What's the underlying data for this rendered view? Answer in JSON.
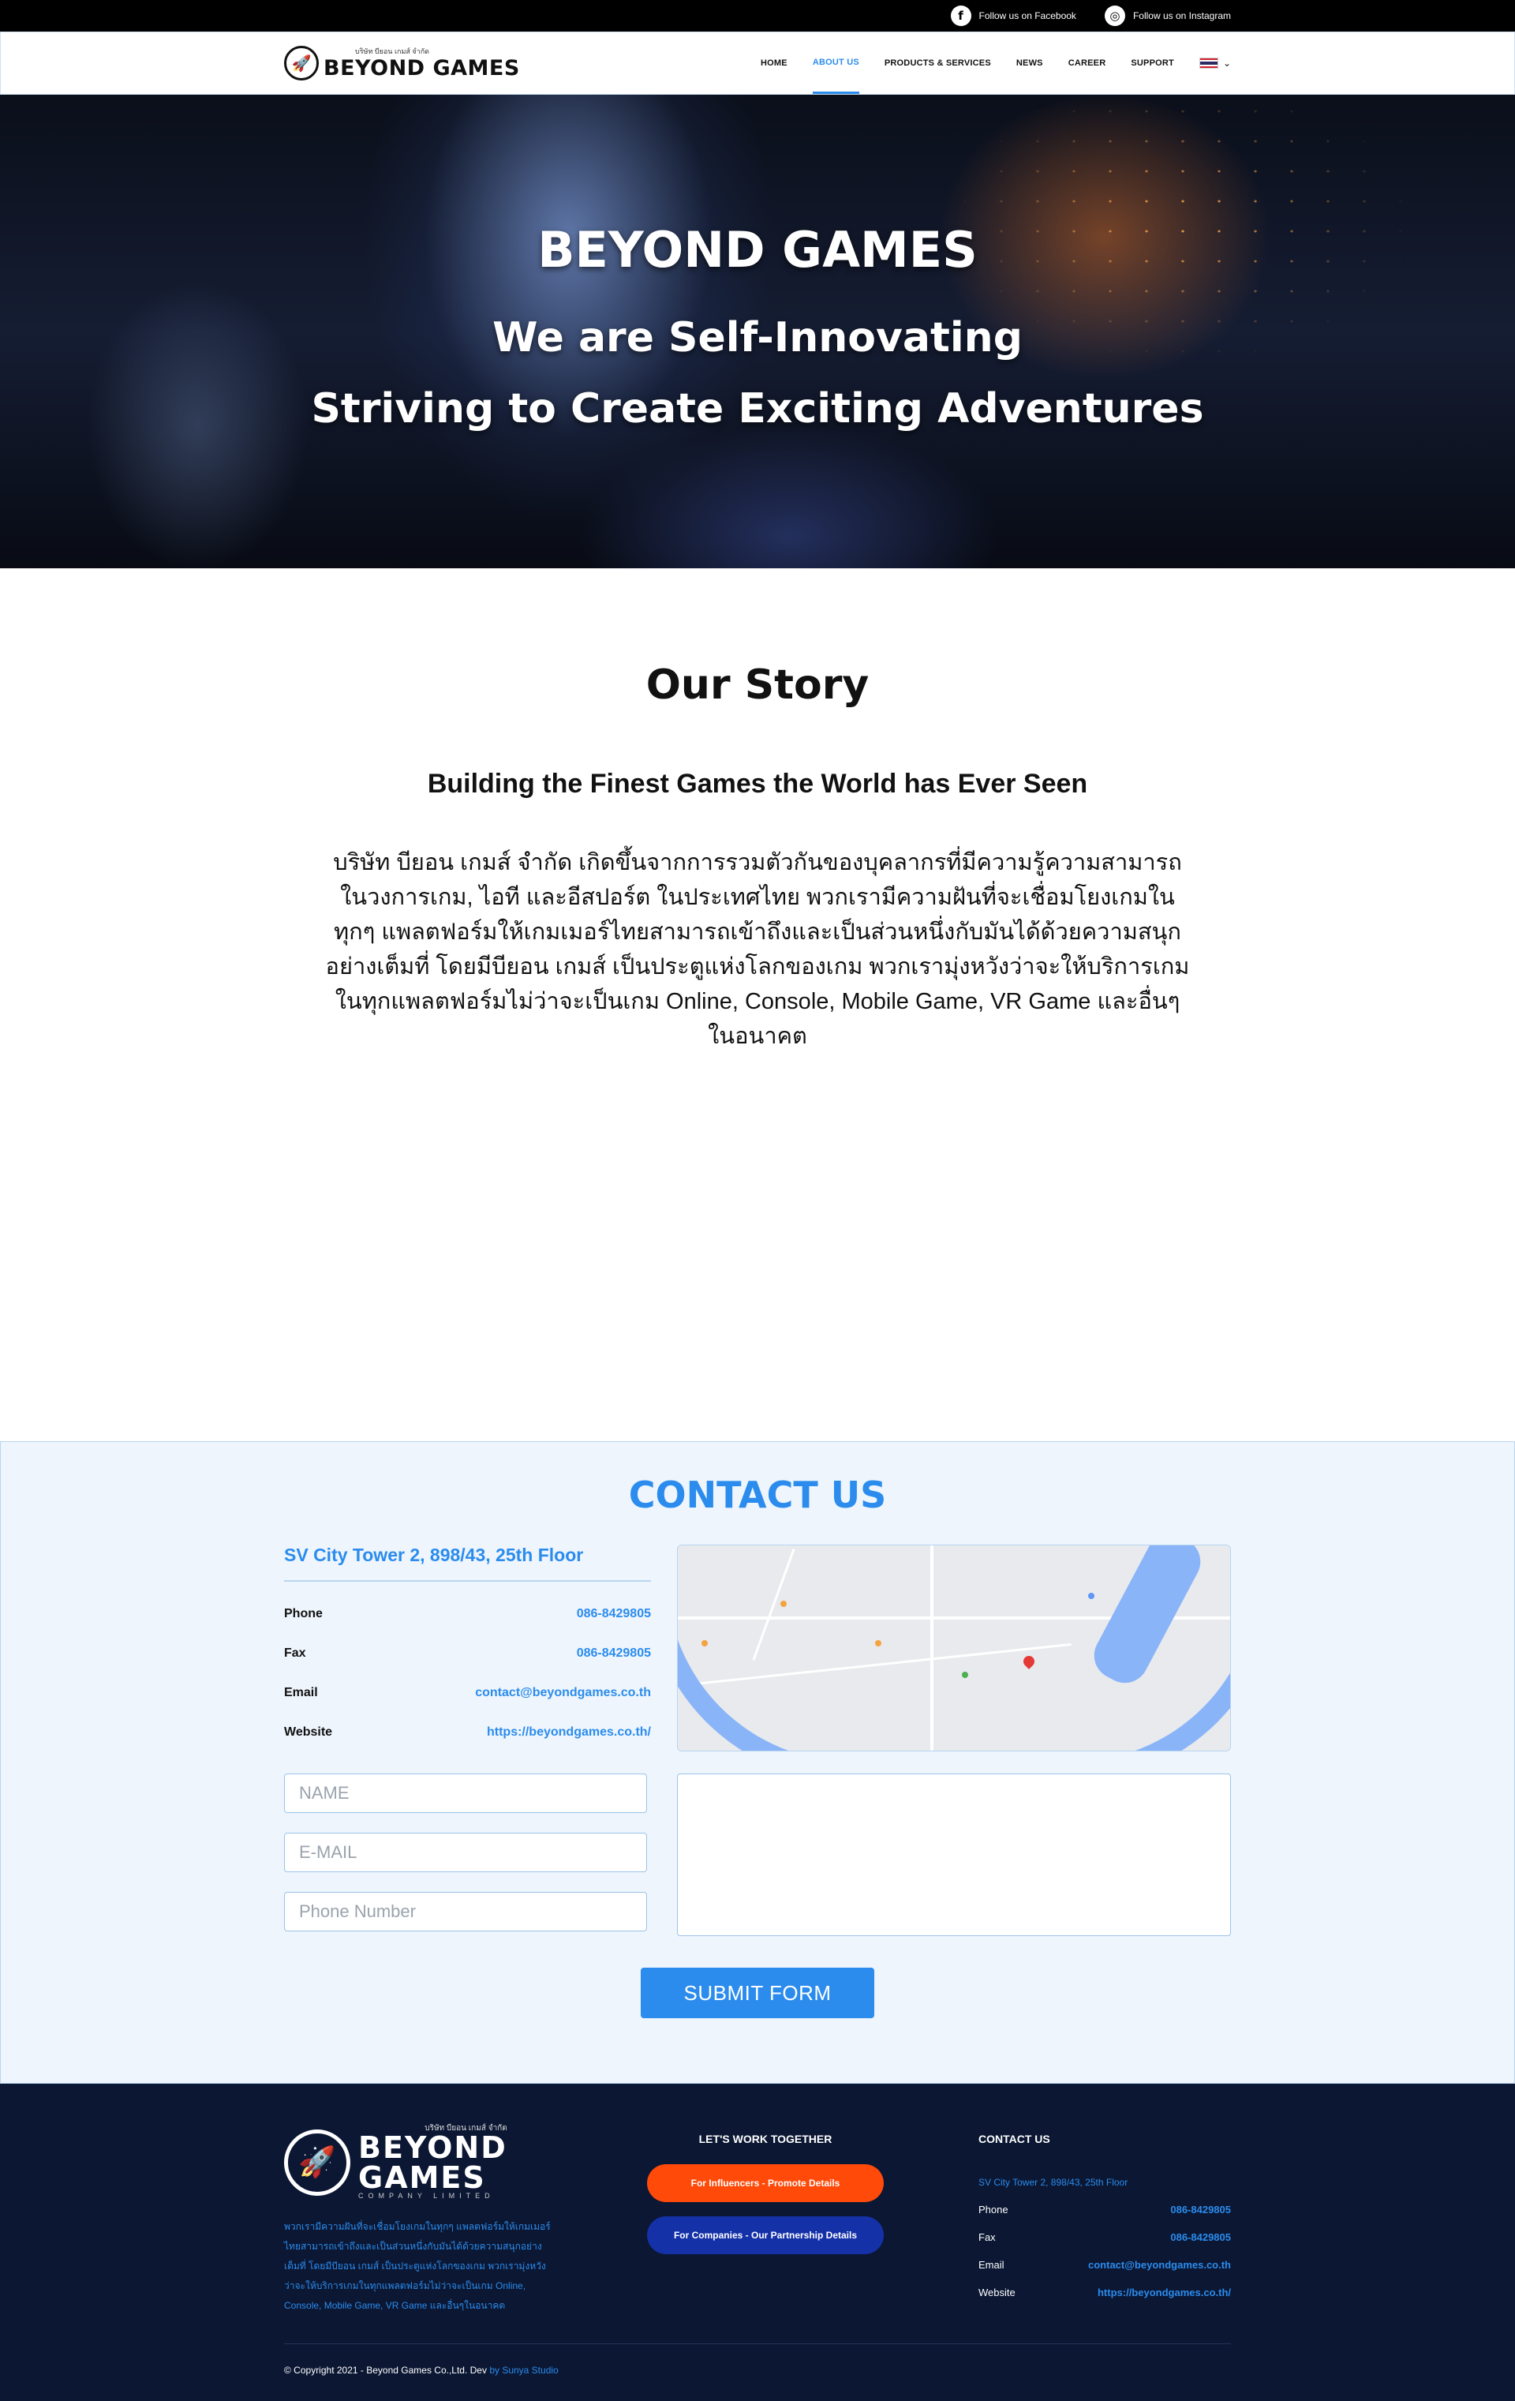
{
  "topbar": {
    "facebook_icon": "f",
    "facebook_label": "Follow us on Facebook",
    "instagram_icon": "◎",
    "instagram_label": "Follow us on Instagram"
  },
  "header": {
    "logo_small": "บริษัท บียอน เกมส์ จำกัด",
    "logo_big": "BEYOND GAMES",
    "nav": [
      "HOME",
      "ABOUT US",
      "PRODUCTS & SERVICES",
      "NEWS",
      "CAREER",
      "SUPPORT"
    ],
    "active_nav": "ABOUT US",
    "lang_caret": "⌄"
  },
  "hero": {
    "title": "BEYOND GAMES",
    "line1": "We are Self-Innovating",
    "line2": "Striving to Create Exciting Adventures"
  },
  "story": {
    "title": "Our Story",
    "subtitle": "Building the Finest Games the World has Ever Seen",
    "body": "บริษัท บียอน เกมส์ จำกัด เกิดขึ้นจากการรวมตัวกันของบุคลากรที่มีความรู้ความสามารถในวงการเกม, ไอที และอีสปอร์ต ในประเทศไทย พวกเรามีความฝันที่จะเชื่อมโยงเกมในทุกๆ แพลตฟอร์มให้เกมเมอร์ไทยสามารถเข้าถึงและเป็นส่วนหนึ่งกับมันได้ด้วยความสนุกอย่างเต็มที่ โดยมีบียอน เกมส์ เป็นประตูแห่งโลกของเกม พวกเรามุ่งหวังว่าจะให้บริการเกมในทุกแพลตฟอร์มไม่ว่าจะเป็นเกม Online, Console, Mobile Game, VR Game และอื่นๆในอนาคต"
  },
  "contact": {
    "title": "CONTACT US",
    "address": "SV City Tower 2, 898/43, 25th Floor",
    "rows": [
      {
        "label": "Phone",
        "value": "086-8429805"
      },
      {
        "label": "Fax",
        "value": "086-8429805"
      },
      {
        "label": "Email",
        "value": "contact@beyondgames.co.th"
      },
      {
        "label": "Website",
        "value": "https://beyondgames.co.th/"
      }
    ],
    "placeholders": {
      "name": "NAME",
      "email": "E-MAIL",
      "phone": "Phone Number"
    },
    "submit": "SUBMIT FORM"
  },
  "footer": {
    "logo_small": "บริษัท บียอน เกมส์ จำกัด",
    "logo_line1": "BEYOND",
    "logo_line2": "GAMES",
    "logo_line3": "COMPANY LIMITED",
    "desc": "พวกเรามีความฝันที่จะเชื่อมโยงเกมในทุกๆ แพลตฟอร์มให้เกมเมอร์ไทยสามารถเข้าถึงและเป็นส่วนหนึ่งกับมันได้ด้วยความสนุกอย่างเต็มที่ โดยมีบียอน เกมส์ เป็นประตูแห่งโลกของเกม พวกเรามุ่งหวังว่าจะให้บริการเกมในทุกแพลตฟอร์มไม่ว่าจะเป็นเกม Online, Console, Mobile Game, VR Game และอื่นๆในอนาคต",
    "work_title": "LET'S WORK TOGETHER",
    "btn_influencers": "For Influencers - Promote Details",
    "btn_companies": "For Companies - Our Partnership Details",
    "contact_title": "CONTACT US",
    "address": "SV City Tower 2, 898/43, 25th Floor",
    "rows": [
      {
        "label": "Phone",
        "value": "086-8429805"
      },
      {
        "label": "Fax",
        "value": "086-8429805"
      },
      {
        "label": "Email",
        "value": "contact@beyondgames.co.th"
      },
      {
        "label": "Website",
        "value": "https://beyondgames.co.th/"
      }
    ],
    "copyright": "© Copyright 2021 - Beyond Games Co.,Ltd. Dev",
    "dev": "by Sunya Studio"
  },
  "colors": {
    "accent": "#2b8ced",
    "footer_bg": "#0b1733",
    "orange": "#ff4a0a",
    "navy": "#1531a8"
  },
  "icons": {
    "facebook": "facebook-icon",
    "instagram": "instagram-icon",
    "flag": "thai-flag-icon",
    "logo": "rocket-logo-icon"
  }
}
